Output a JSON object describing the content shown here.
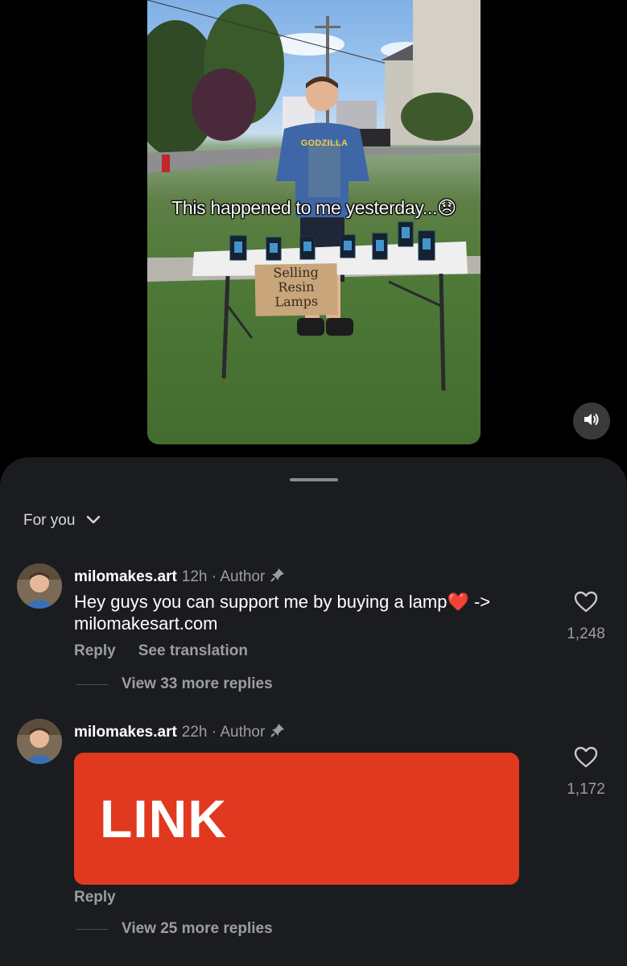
{
  "video": {
    "caption": "This happened to me yesterday...😞",
    "sign_text": "Selling\nResin\nLamps",
    "shirt_text": "GODZILLA",
    "sound_icon": "speaker-on-icon"
  },
  "comments_sheet": {
    "filter_label": "For you",
    "comments": [
      {
        "username": "milomakes.art",
        "meta": "12h · Author",
        "text": "Hey guys you can support me by buying a lamp❤️ -> milomakesart.com",
        "reply_label": "Reply",
        "translate_label": "See translation",
        "view_replies": "View 33 more replies",
        "likes": "1,248"
      },
      {
        "username": "milomakes.art",
        "meta": "22h · Author",
        "link_card_text": "LINK",
        "link_card_color": "#e0391f",
        "reply_label": "Reply",
        "view_replies": "View 25 more replies",
        "likes": "1,172"
      }
    ]
  }
}
